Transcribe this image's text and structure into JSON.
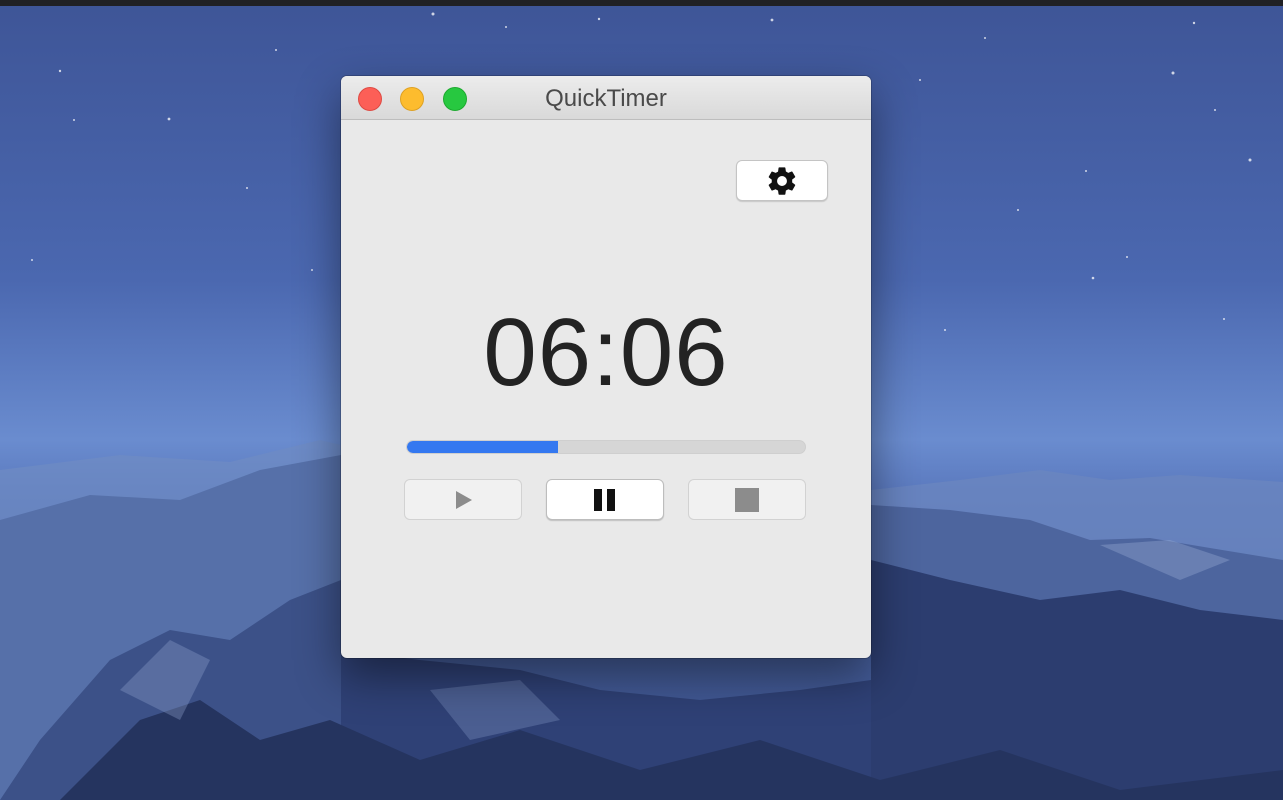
{
  "window": {
    "title": "QuickTimer"
  },
  "timer": {
    "time_display": "06:06",
    "progress": 0.38
  },
  "icons": {
    "settings": "gear-icon",
    "play": "play-icon",
    "pause": "pause-icon",
    "stop": "stop-icon"
  },
  "colors": {
    "progress_fill": "#3478f0",
    "close": "#fc5f57",
    "minimize": "#fdbc2e",
    "zoom": "#27c840"
  }
}
